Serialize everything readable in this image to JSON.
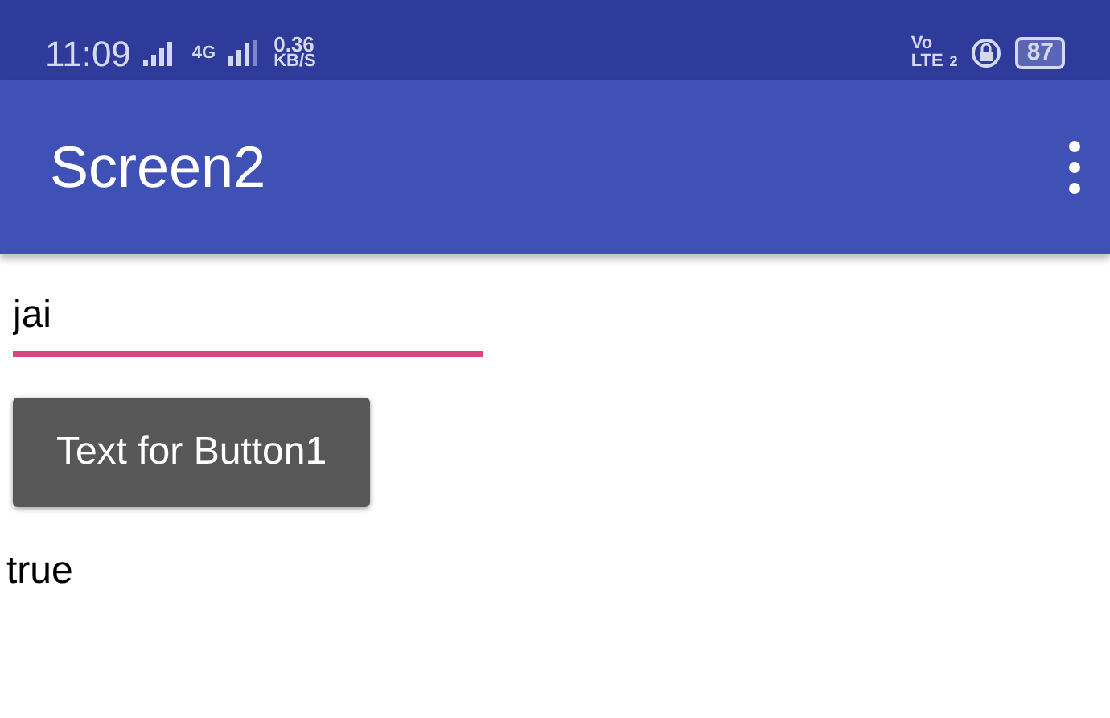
{
  "status_bar": {
    "time": "11:09",
    "network": "4G",
    "speed": "0.36",
    "speed_unit": "KB/S",
    "volte": "Vo",
    "lte": "LTE",
    "sim": "2",
    "battery": "87"
  },
  "app_bar": {
    "title": "Screen2"
  },
  "text_field": {
    "value": "jai",
    "focused": true
  },
  "button": {
    "label": "Text for Button1"
  },
  "label": {
    "text": "true"
  }
}
